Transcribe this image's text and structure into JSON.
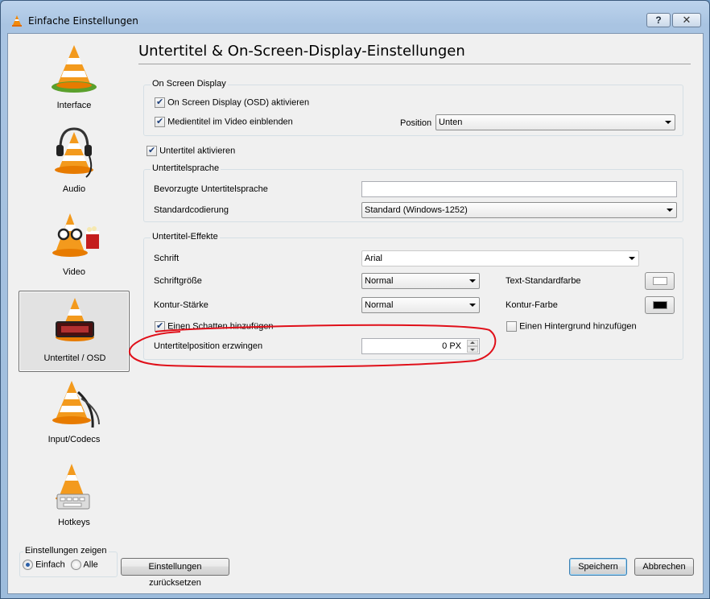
{
  "window": {
    "title": "Einfache Einstellungen",
    "help_label": "?",
    "close_label": "✕"
  },
  "sidebar": {
    "items": [
      {
        "label": "Interface",
        "icon": "vlc-cone-icon"
      },
      {
        "label": "Audio",
        "icon": "headphones-cone-icon"
      },
      {
        "label": "Video",
        "icon": "glasses-cone-icon"
      },
      {
        "label": "Untertitel / OSD",
        "icon": "subtitle-cone-icon",
        "selected": true
      },
      {
        "label": "Input/Codecs",
        "icon": "cable-cone-icon"
      },
      {
        "label": "Hotkeys",
        "icon": "keyboard-cone-icon"
      }
    ],
    "show_settings": {
      "legend": "Einstellungen zeigen",
      "simple_label": "Einfach",
      "all_label": "Alle",
      "selected": "Einfach"
    }
  },
  "page": {
    "title": "Untertitel & On-Screen-Display-Einstellungen"
  },
  "osd": {
    "legend": "On Screen Display",
    "enable_osd_label": "On Screen Display (OSD) aktivieren",
    "enable_osd_checked": true,
    "show_title_label": "Medientitel im Video einblenden",
    "show_title_checked": true,
    "position_label": "Position",
    "position_value": "Unten"
  },
  "subtitles": {
    "enable_label": "Untertitel aktivieren",
    "enable_checked": true
  },
  "language": {
    "legend": "Untertitelsprache",
    "preferred_label": "Bevorzugte Untertitelsprache",
    "preferred_value": "",
    "encoding_label": "Standardcodierung",
    "encoding_value": "Standard (Windows-1252)"
  },
  "effects": {
    "legend": "Untertitel-Effekte",
    "font_label": "Schrift",
    "font_value": "Arial",
    "size_label": "Schriftgröße",
    "size_value": "Normal",
    "text_color_label": "Text-Standardfarbe",
    "text_color": "#ffffff",
    "outline_label": "Kontur-Stärke",
    "outline_value": "Normal",
    "outline_color_label": "Kontur-Farbe",
    "outline_color": "#000000",
    "shadow_label": "Einen Schatten hinzufügen",
    "shadow_checked": true,
    "background_label": "Einen Hintergrund hinzufügen",
    "background_checked": false,
    "force_position_label": "Untertitelposition erzwingen",
    "force_position_value": "0 PX"
  },
  "annotation": {
    "color": "#e0101a"
  },
  "footer": {
    "reset_label": "Einstellungen zurücksetzen",
    "save_label": "Speichern",
    "cancel_label": "Abbrechen"
  }
}
